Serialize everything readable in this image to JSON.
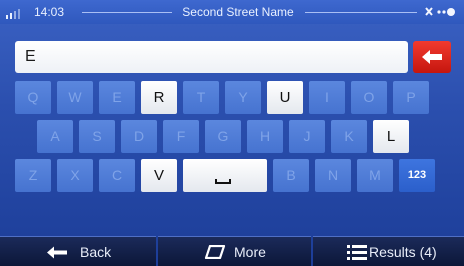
{
  "status": {
    "time": "14:03",
    "street": "Second Street Name",
    "icons": [
      "signal-icon",
      "gps-satellite-icon"
    ]
  },
  "search": {
    "value": "E",
    "backspace_icon": "backspace-arrow-icon"
  },
  "keyboard": {
    "rows": [
      [
        "Q",
        "W",
        "E",
        "R",
        "T",
        "Y",
        "U",
        "I",
        "O",
        "P"
      ],
      [
        "A",
        "S",
        "D",
        "F",
        "G",
        "H",
        "J",
        "K",
        "L"
      ],
      [
        "Z",
        "X",
        "C",
        "V",
        "space",
        "B",
        "N",
        "M",
        "123"
      ]
    ],
    "enabled_keys": [
      "R",
      "U",
      "L",
      "V",
      "space"
    ],
    "space_label": "␣",
    "numeric_label": "123"
  },
  "bottom": {
    "back_label": "Back",
    "more_label": "More",
    "results_label": "Results (4)"
  },
  "colors": {
    "background": "#2b4fae",
    "key_disabled": "#4f7ad6",
    "key_enabled": "#ffffff",
    "backspace": "#d9241b",
    "bottom_bar": "#122050"
  }
}
